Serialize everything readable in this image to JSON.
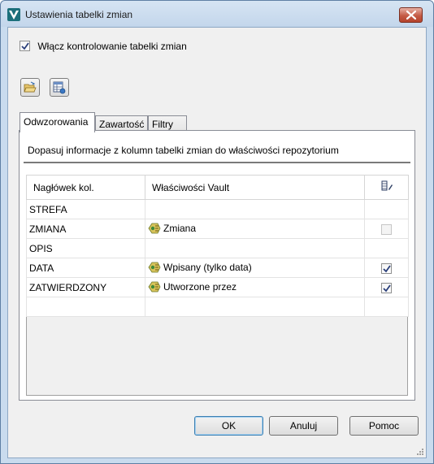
{
  "window": {
    "title": "Ustawienia tabelki zmian"
  },
  "enable_checkbox": {
    "label": "Włącz kontrolowanie tabelki zmian",
    "checked": true
  },
  "toolbar": {
    "buttons": [
      {
        "icon": "open-folder-icon"
      },
      {
        "icon": "table-settings-icon"
      }
    ]
  },
  "tabs": [
    {
      "label": "Odwzorowania",
      "active": true
    },
    {
      "label": "Zawartość",
      "active": false
    },
    {
      "label": "Filtry",
      "active": false
    }
  ],
  "panel": {
    "description": "Dopasuj informacje z kolumn tabelki zmian do właściwości repozytorium"
  },
  "grid": {
    "columns": [
      "Nagłówek kol.",
      "Właściwości Vault"
    ],
    "third_column_icon": "edit-column-icon",
    "rows": [
      {
        "header": "STREFA",
        "property": "",
        "checkbox": "none"
      },
      {
        "header": "ZMIANA",
        "property": "Zmiana",
        "checkbox": "disabled-unchecked"
      },
      {
        "header": "OPIS",
        "property": "",
        "checkbox": "none"
      },
      {
        "header": "DATA",
        "property": "Wpisany (tylko data)",
        "checkbox": "checked"
      },
      {
        "header": "ZATWIERDZONY",
        "property": "Utworzone przez",
        "checkbox": "checked"
      },
      {
        "header": "",
        "property": "",
        "checkbox": "none"
      }
    ]
  },
  "buttons": {
    "ok": "OK",
    "cancel": "Anuluj",
    "help": "Pomoc"
  },
  "colors": {
    "frame": "#c9dbee",
    "close_button": "#c45b45",
    "default_button_border": "#3c7fb1"
  }
}
